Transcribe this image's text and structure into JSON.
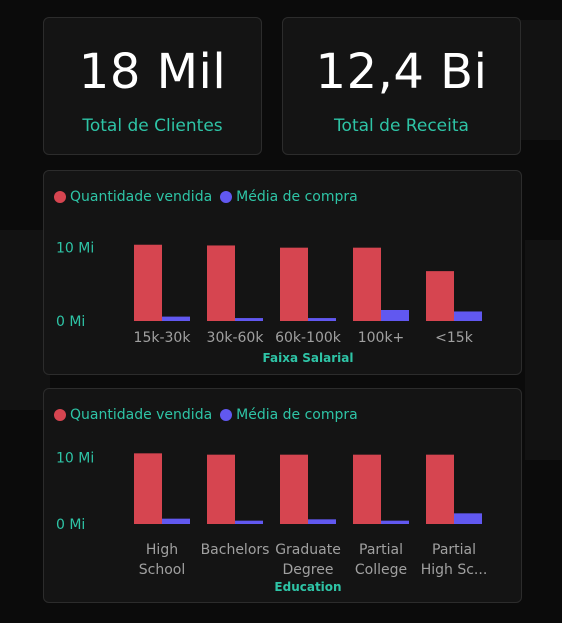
{
  "kpis": [
    {
      "value": "18 Mil",
      "label": "Total de Clientes"
    },
    {
      "value": "12,4 Bi",
      "label": "Total de Receita"
    }
  ],
  "colors": {
    "sold": "#d64550",
    "avg": "#6158f0",
    "accent": "#2ec4a6",
    "tick": "#a0a0a0"
  },
  "chart_data": [
    {
      "type": "bar",
      "legend": [
        "Quantidade vendida",
        "Média de compra"
      ],
      "xlabel": "Faixa Salarial",
      "ytick_labels": [
        "10 Mi",
        "0 Mi"
      ],
      "categories": [
        [
          "15k-30k"
        ],
        [
          "30k-60k"
        ],
        [
          "60k-100k"
        ],
        [
          "100k+"
        ],
        [
          "<15k"
        ]
      ],
      "ylim": [
        0,
        15
      ],
      "series": [
        {
          "name": "Quantidade vendida",
          "values": [
            10.4,
            10.3,
            10.0,
            10.0,
            6.8
          ]
        },
        {
          "name": "Média de compra",
          "values": [
            0.6,
            0.4,
            0.4,
            1.5,
            1.3
          ]
        }
      ]
    },
    {
      "type": "bar",
      "legend": [
        "Quantidade vendida",
        "Média de compra"
      ],
      "xlabel": "Education",
      "ytick_labels": [
        "10 Mi",
        "0 Mi"
      ],
      "categories": [
        [
          "High",
          "School"
        ],
        [
          "Bachelors"
        ],
        [
          "Graduate",
          "Degree"
        ],
        [
          "Partial",
          "College"
        ],
        [
          "Partial",
          "High Sc..."
        ]
      ],
      "ylim": [
        0,
        15
      ],
      "series": [
        {
          "name": "Quantidade vendida",
          "values": [
            10.6,
            10.4,
            10.4,
            10.4,
            10.4
          ]
        },
        {
          "name": "Média de compra",
          "values": [
            0.8,
            0.5,
            0.7,
            0.5,
            1.6
          ]
        }
      ]
    }
  ]
}
